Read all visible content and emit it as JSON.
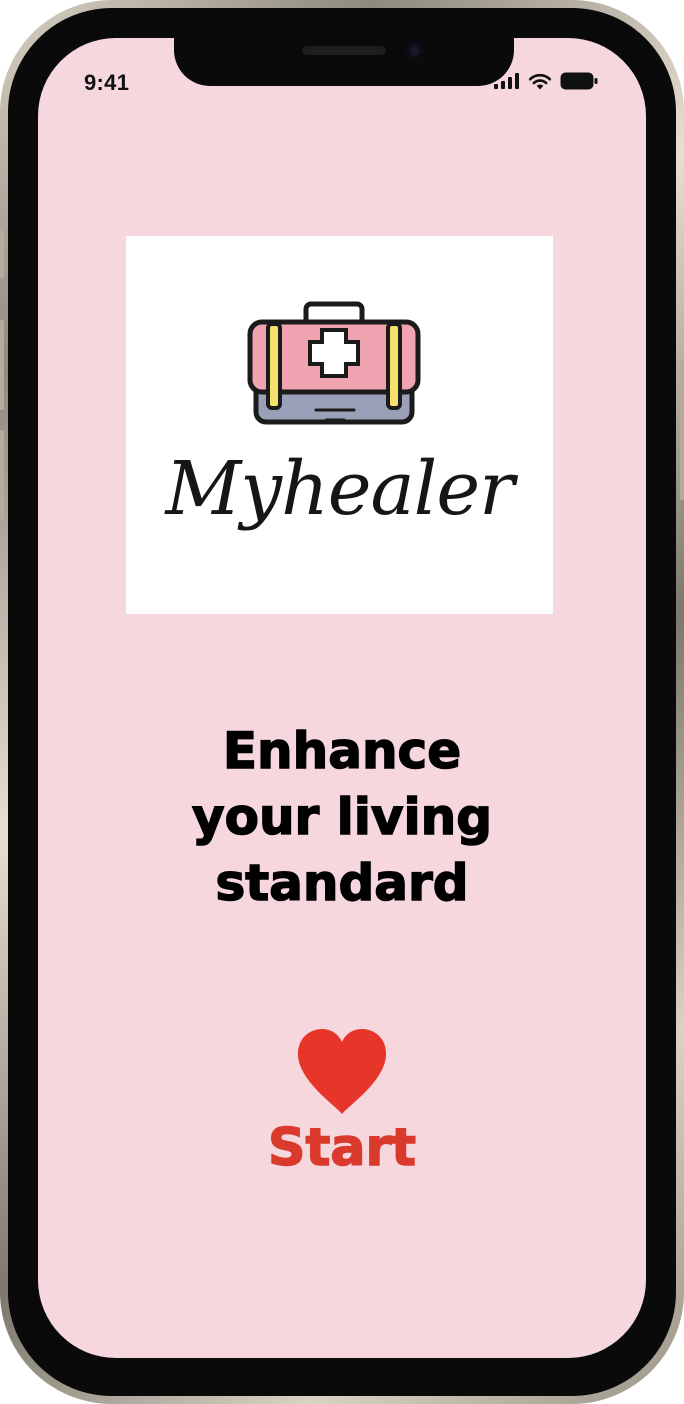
{
  "status_bar": {
    "time": "9:41",
    "icons": [
      "cellular-signal-icon",
      "wifi-icon",
      "battery-icon"
    ]
  },
  "logo": {
    "icon": "medical-kit-icon",
    "brand_name": "Myhealer"
  },
  "tagline": {
    "line1": "Enhance",
    "line2": "your living",
    "line3": "standard"
  },
  "start": {
    "icon": "heart-icon",
    "label": "Start",
    "color": "#d93a2c"
  },
  "colors": {
    "screen_background": "#f6d7de",
    "logo_background": "#ffffff",
    "accent": "#e8352a"
  }
}
